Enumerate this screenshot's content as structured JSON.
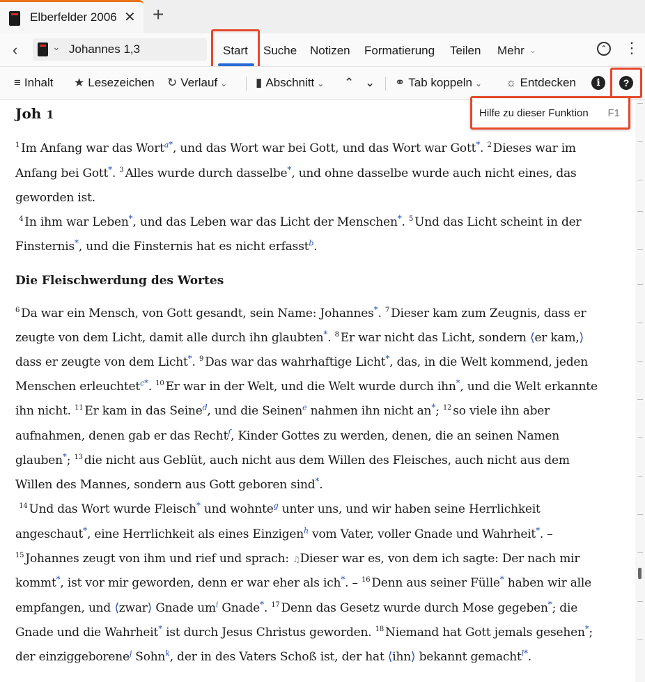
{
  "tab": {
    "title": "Elberfelder 2006",
    "close": "✕",
    "add": "+"
  },
  "nav": {
    "reference": "Johannes 1,3",
    "menu": [
      "Start",
      "Suche",
      "Notizen",
      "Formatierung",
      "Teilen",
      "Mehr"
    ]
  },
  "toolbar": {
    "contents": "Inhalt",
    "bookmarks": "Lesezeichen",
    "history": "Verlauf",
    "section": "Abschnitt",
    "link_tab": "Tab koppeln",
    "discover": "Entdecken"
  },
  "tooltip": {
    "text": "Hilfe zu dieser Funktion",
    "key": "F1"
  },
  "chapter": {
    "book": "Joh",
    "number": "1"
  },
  "heading": "Die Fleischwerdung des Wortes",
  "colors": {
    "accent_blue": "#2a6ad4",
    "highlight_red": "#e5482b",
    "tab_orange": "#e8731c",
    "footnote_blue": "#2a4fb0"
  },
  "icons": [
    "back-arrow-icon",
    "book-icon",
    "chevron-down-icon",
    "collapse-up-icon",
    "more-vertical-icon",
    "list-icon",
    "star-icon",
    "history-icon",
    "chart-icon",
    "arrow-up-icon",
    "arrow-down-icon",
    "link-icon",
    "lightbulb-icon",
    "info-icon",
    "help-icon",
    "audio-icon"
  ]
}
